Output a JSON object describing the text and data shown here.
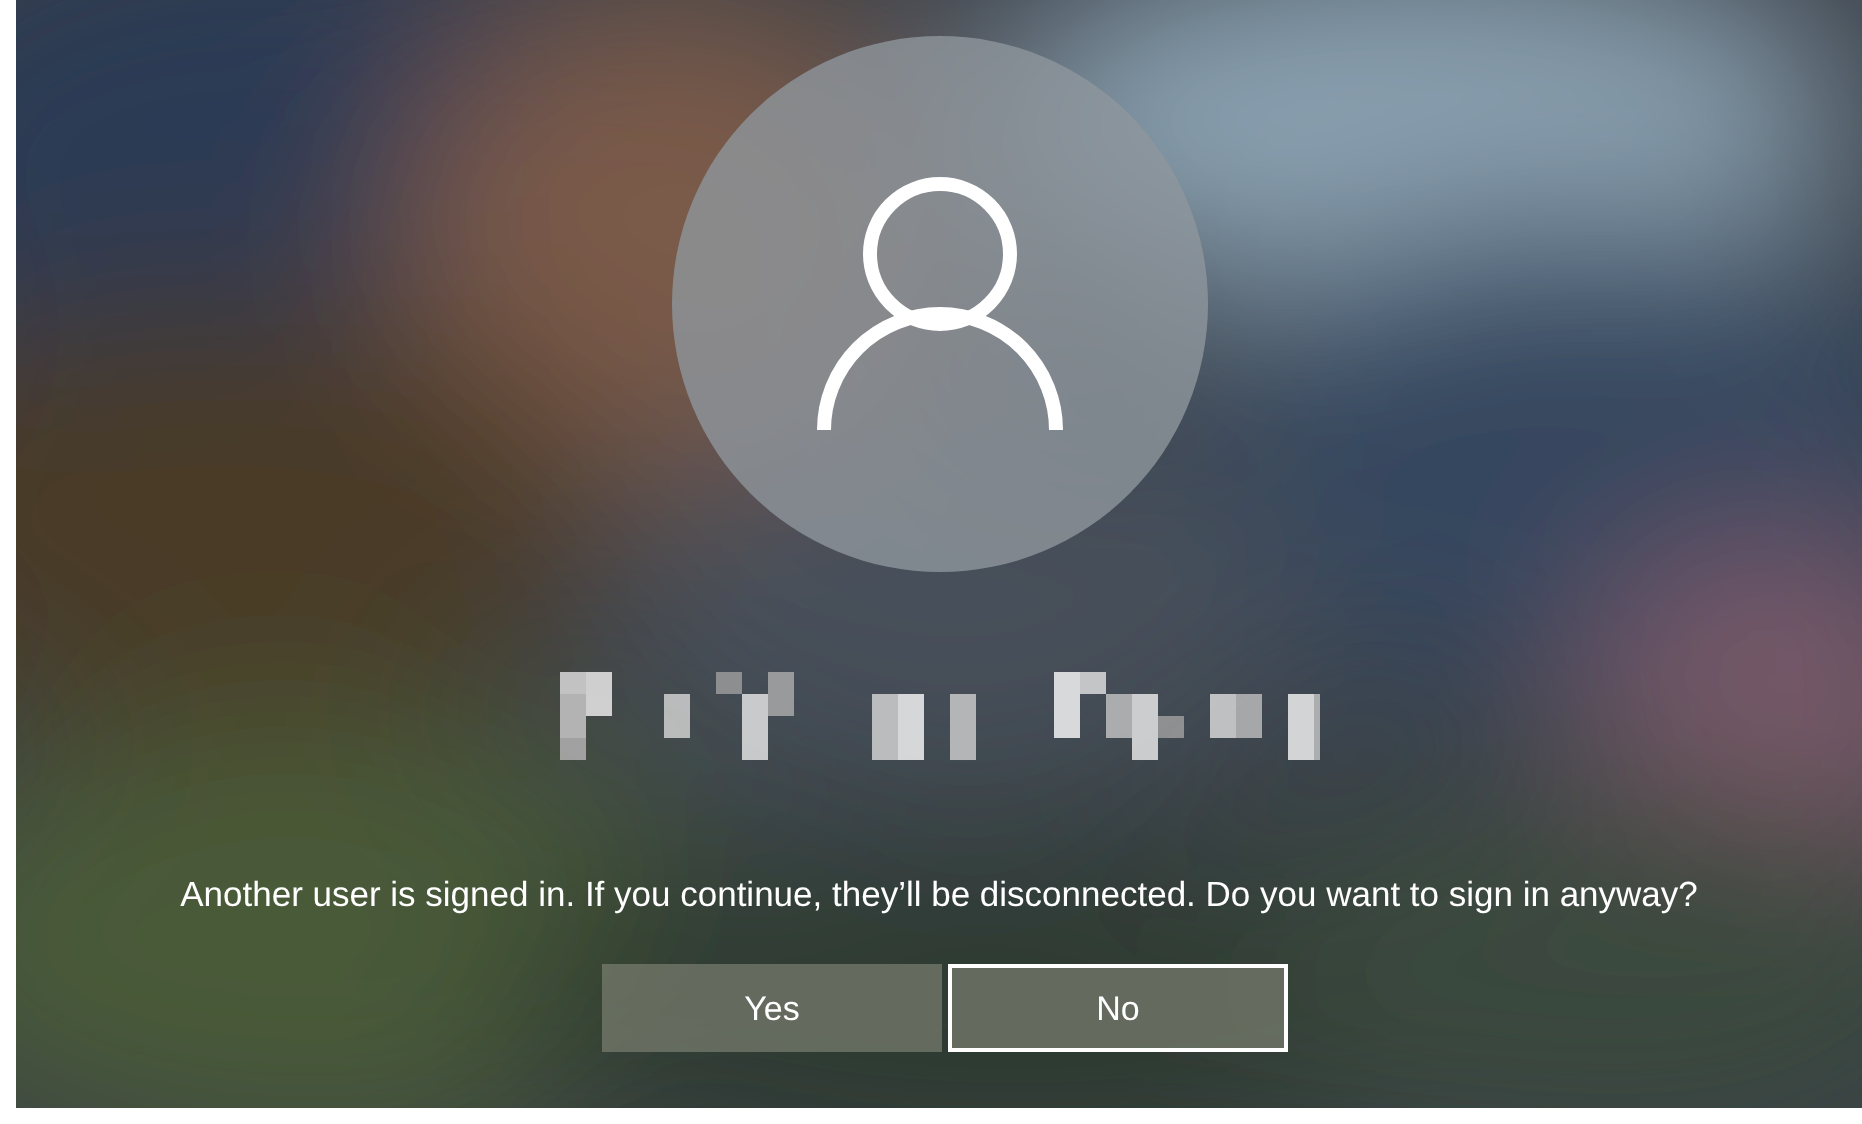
{
  "message": "Another user is signed in. If you continue, they’ll be disconnected. Do you want to sign in anyway?",
  "buttons": [
    {
      "label": "Yes",
      "focused": false
    },
    {
      "label": "No",
      "focused": true
    }
  ]
}
